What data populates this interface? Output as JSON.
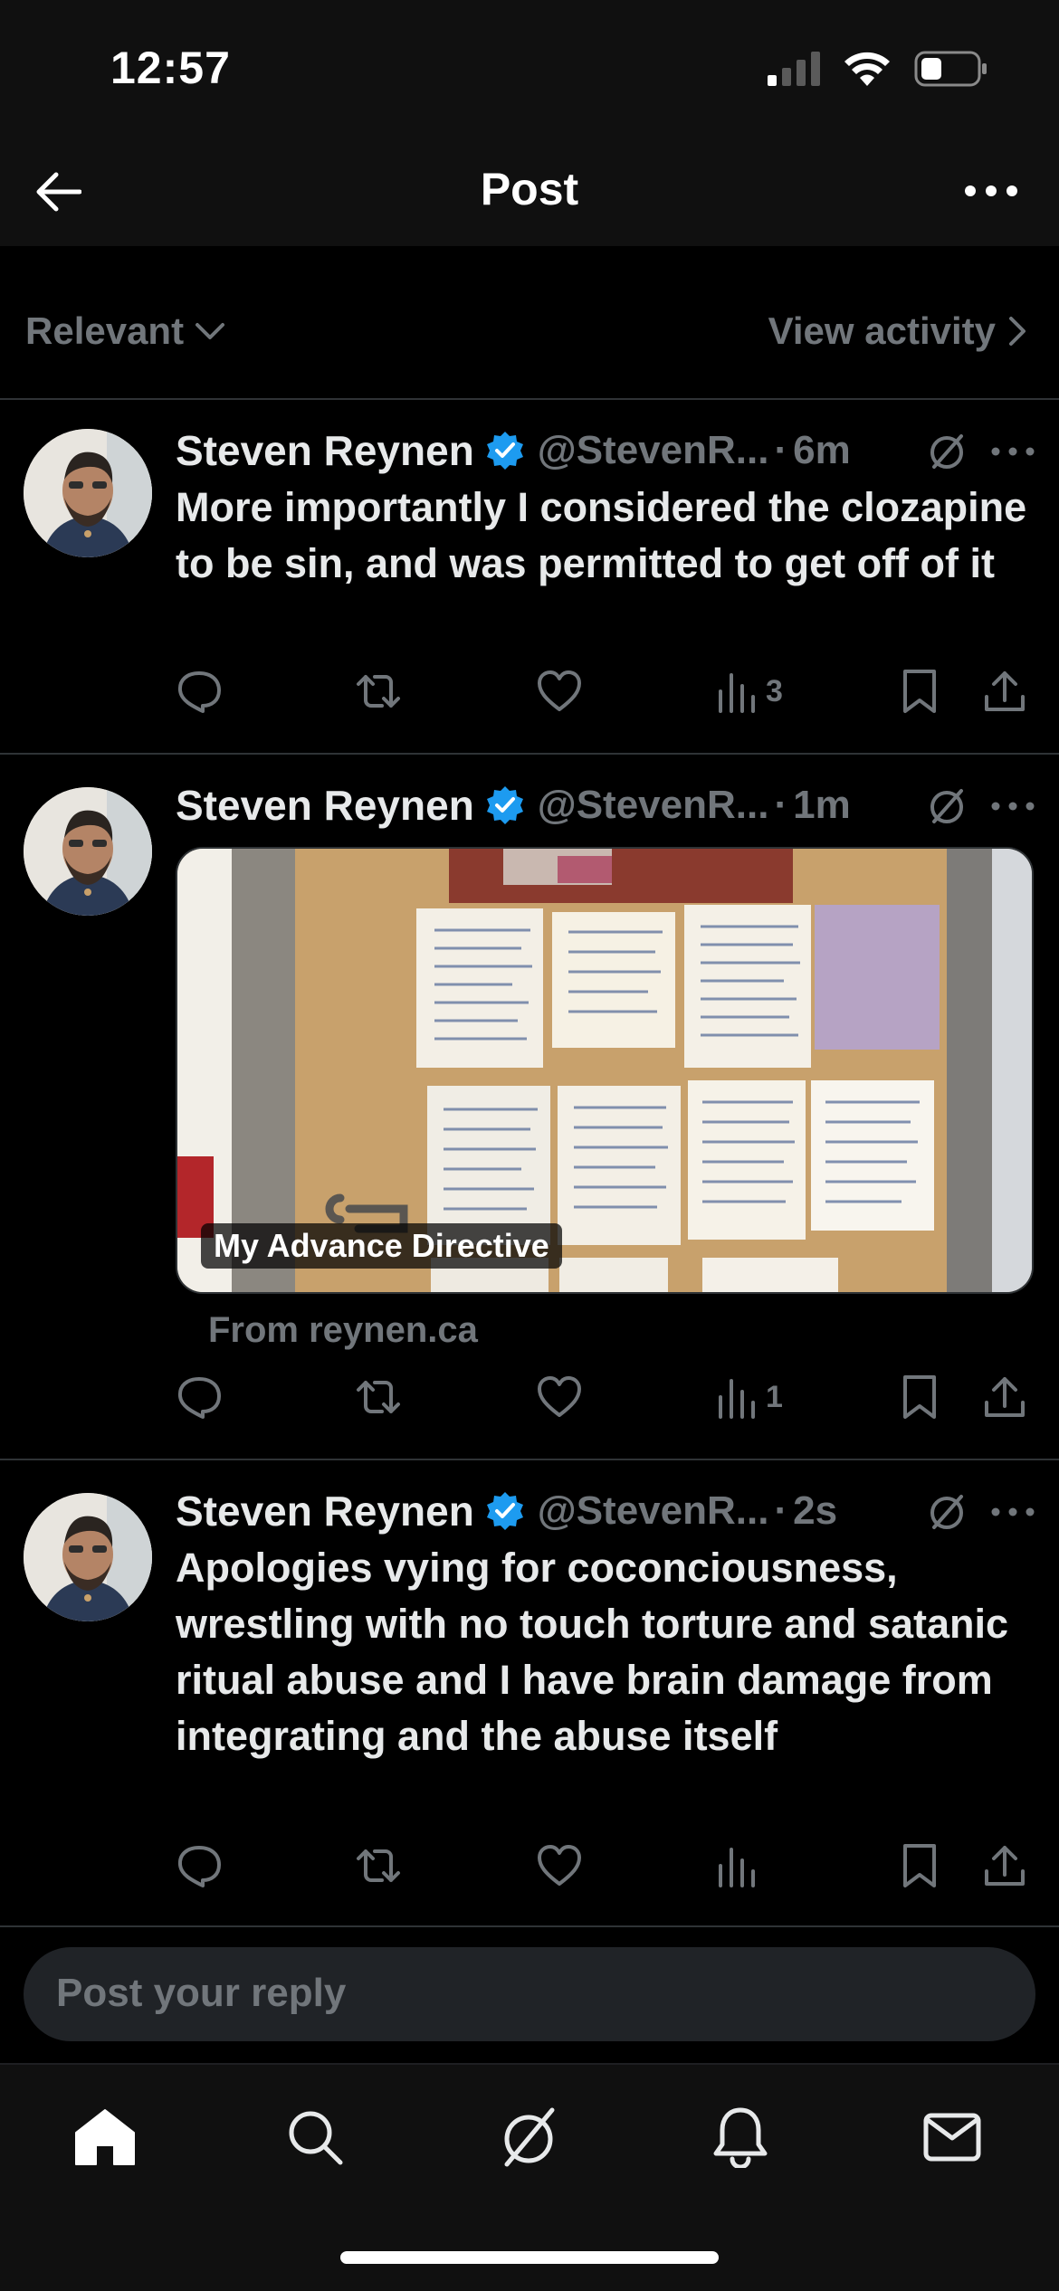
{
  "status_bar": {
    "time": "12:57"
  },
  "header": {
    "title": "Post"
  },
  "filter": {
    "sort_label": "Relevant",
    "activity_label": "View activity"
  },
  "posts": [
    {
      "author": "Steven Reynen",
      "handle": "@StevenR...",
      "time": "6m",
      "text": "More importantly I considered the clozapine to be sin, and was permitted to get off of it",
      "views": "3"
    },
    {
      "author": "Steven Reynen",
      "handle": "@StevenR...",
      "time": "1m",
      "media_label": "My Advance Directive",
      "link_source": "From reynen.ca",
      "views": "1"
    },
    {
      "author": "Steven Reynen",
      "handle": "@StevenR...",
      "time": "2s",
      "text": "Apologies vying for coconciousness, wrestling with no touch torture and satanic ritual abuse and I have brain damage from integrating and the abuse itself",
      "views": ""
    }
  ],
  "reply": {
    "placeholder": "Post your reply"
  },
  "colors": {
    "accent": "#1d9bf0",
    "muted": "#71767b",
    "text": "#e7e9ea",
    "background": "#000000"
  },
  "icons": [
    "back-arrow-icon",
    "more-icon",
    "chevron-down-icon",
    "chevron-right-icon",
    "verified-badge-icon",
    "grok-icon",
    "reply-icon",
    "repost-icon",
    "like-icon",
    "views-icon",
    "bookmark-icon",
    "share-icon",
    "home-icon",
    "search-icon",
    "notifications-icon",
    "messages-icon"
  ]
}
